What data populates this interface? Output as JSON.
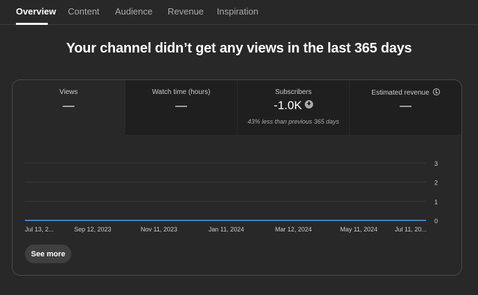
{
  "tabs": [
    {
      "label": "Overview",
      "active": true
    },
    {
      "label": "Content",
      "active": false
    },
    {
      "label": "Audience",
      "active": false
    },
    {
      "label": "Revenue",
      "active": false
    },
    {
      "label": "Inspiration",
      "active": false
    }
  ],
  "headline": "Your channel didn’t get any views in the last 365 days",
  "metrics": [
    {
      "label": "Views",
      "value": "—",
      "sub": ""
    },
    {
      "label": "Watch time (hours)",
      "value": "—",
      "sub": ""
    },
    {
      "label": "Subscribers",
      "value": "-1.0K",
      "sub": "43% less than previous 365 days",
      "trend_icon": "arrow-down-circle-icon"
    },
    {
      "label": "Estimated revenue",
      "value": "—",
      "sub": "",
      "info_icon": "clock-icon"
    }
  ],
  "colors": {
    "line": "#3ea6ff",
    "grid": "#3a3a3a",
    "axis_text": "#cccccc"
  },
  "chart_data": {
    "type": "line",
    "x": [
      "Jul 13, 2...",
      "Sep 12, 2023",
      "Nov 11, 2023",
      "Jan 11, 2024",
      "Mar 12, 2024",
      "May 11, 2024",
      "Jul 11, 20..."
    ],
    "y_ticks": [
      0,
      1,
      2,
      3
    ],
    "ylim": [
      0,
      3
    ],
    "series": [
      {
        "values": [
          0,
          0,
          0,
          0,
          0,
          0,
          0
        ]
      }
    ]
  },
  "see_more_label": "See more"
}
